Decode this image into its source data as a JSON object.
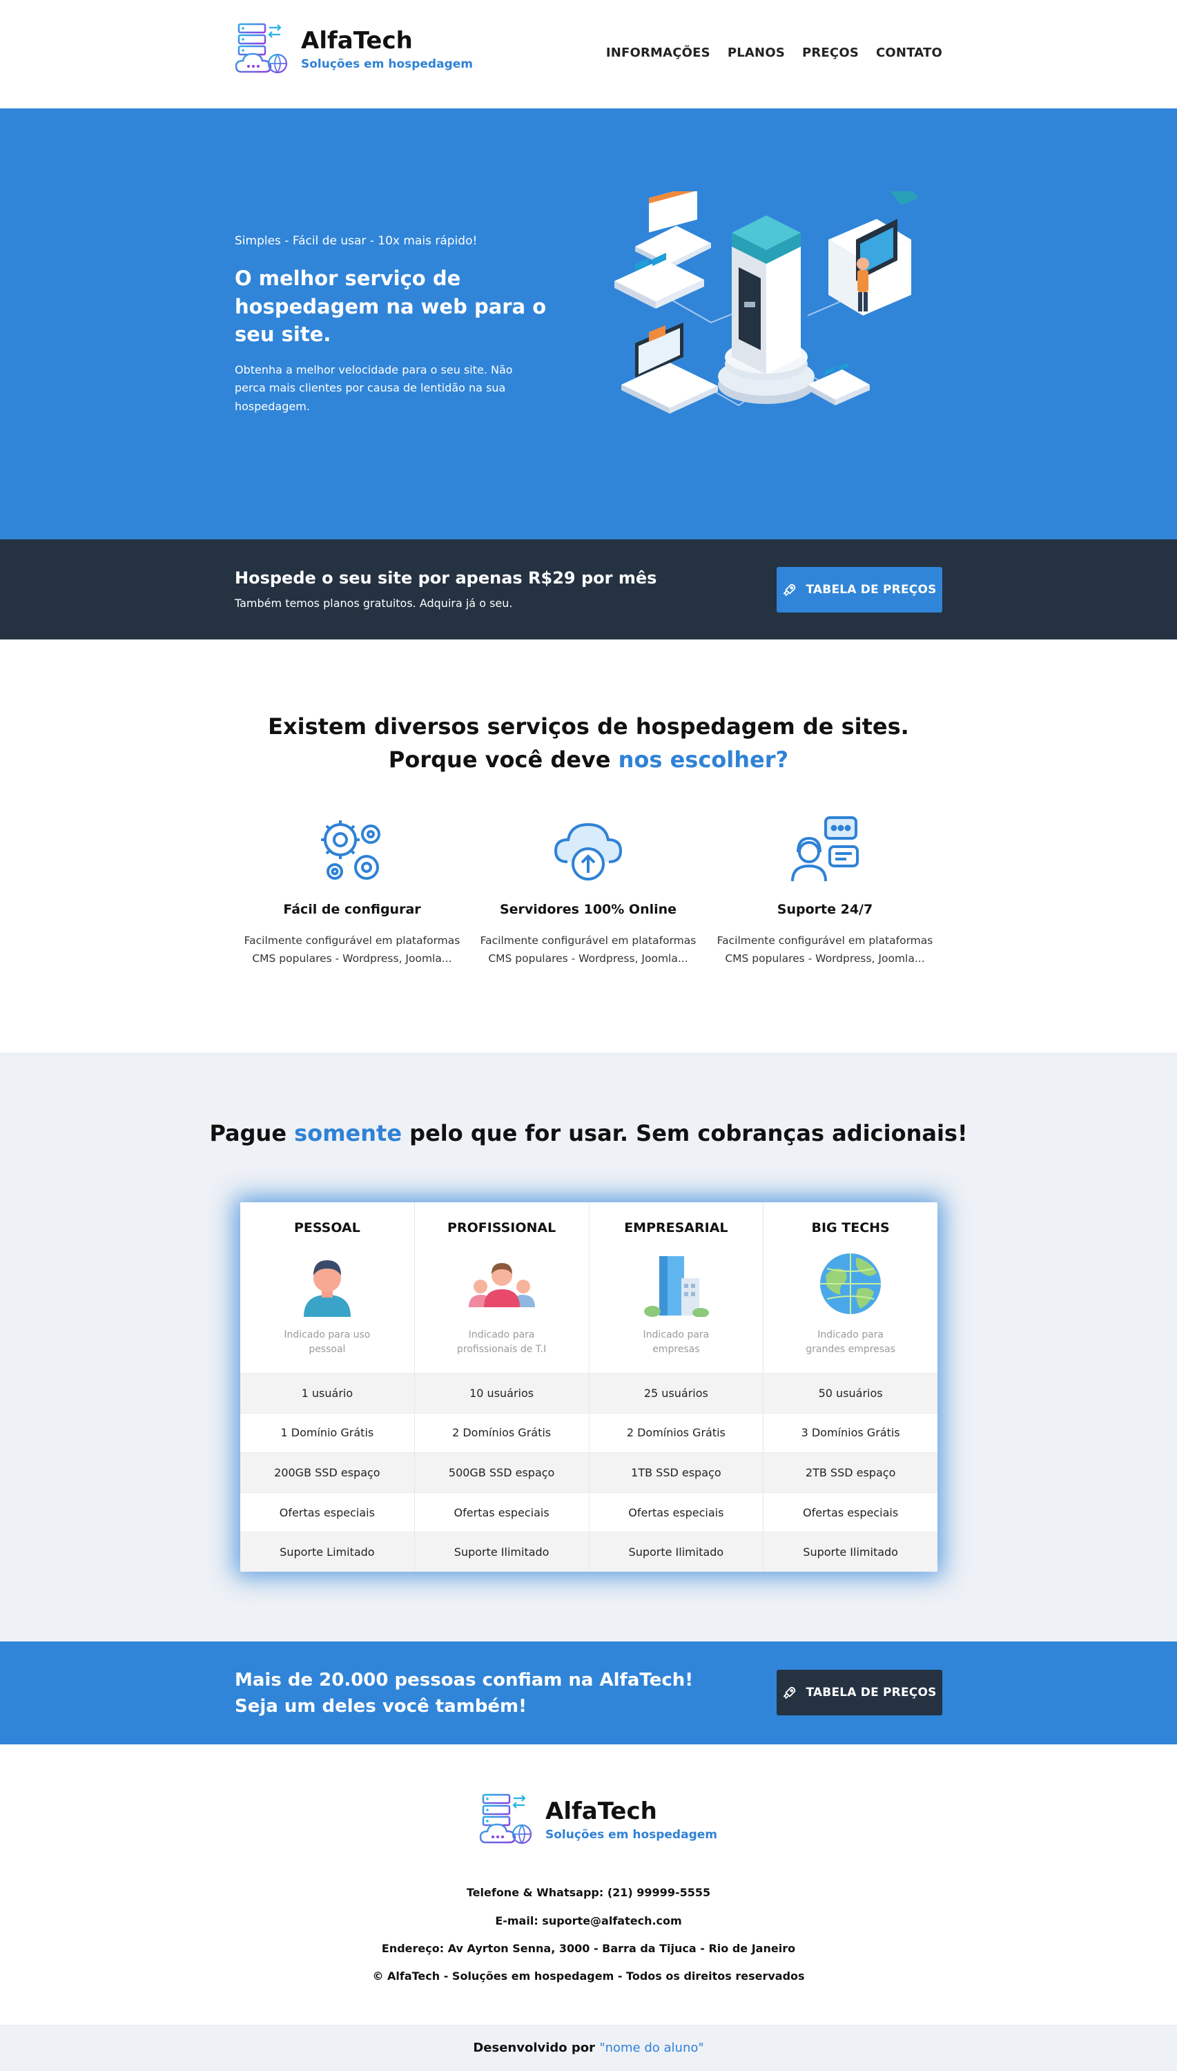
{
  "brand": {
    "name": "AlfaTech",
    "tagline": "Soluções em hospedagem"
  },
  "nav": {
    "items": [
      "INFORMAÇÕES",
      "PLANOS",
      "PREÇOS",
      "CONTATO"
    ]
  },
  "hero": {
    "tagline": "Simples - Fácil de usar - 10x mais rápido!",
    "title": "O melhor serviço de hospedagem na web para o seu site.",
    "text": "Obtenha a melhor velocidade para o seu site. Não perca mais clientes por causa de lentidão na sua hospedagem."
  },
  "promo": {
    "title": "Hospede o seu site por apenas R$29 por mês",
    "subtitle": "Também temos planos gratuitos. Adquira já o seu.",
    "button": "TABELA DE PREÇOS"
  },
  "features": {
    "title_line1": "Existem diversos serviços de hospedagem de sites.",
    "title_line2_prefix": "Porque você deve ",
    "title_line2_accent": "nos escolher?",
    "items": [
      {
        "icon": "gears-icon",
        "title": "Fácil de configurar",
        "text": "Facilmente configurável em plataformas CMS populares - Wordpress, Joomla..."
      },
      {
        "icon": "cloud-upload-icon",
        "title": "Servidores 100% Online",
        "text": "Facilmente configurável em plataformas CMS populares - Wordpress, Joomla..."
      },
      {
        "icon": "support-agent-icon",
        "title": "Suporte 24/7",
        "text": "Facilmente configurável em plataformas CMS populares - Wordpress, Joomla..."
      }
    ]
  },
  "pricing": {
    "title_prefix": "Pague ",
    "title_accent": "somente",
    "title_suffix": " pelo que for usar. Sem cobranças adicionais!",
    "plans": [
      {
        "name": "PESSOAL",
        "image": "person-icon",
        "desc": "Indicado para uso pessoal",
        "features": [
          "1 usuário",
          "1 Domínio Grátis",
          "200GB SSD espaço",
          "Ofertas especiais",
          "Suporte Limitado"
        ]
      },
      {
        "name": "PROFISSIONAL",
        "image": "team-icon",
        "desc": "Indicado para profissionais de T.I",
        "features": [
          "10 usuários",
          "2 Domínios Grátis",
          "500GB SSD espaço",
          "Ofertas especiais",
          "Suporte Ilimitado"
        ]
      },
      {
        "name": "EMPRESARIAL",
        "image": "building-icon",
        "desc": "Indicado para empresas",
        "features": [
          "25 usuários",
          "2 Domínios Grátis",
          "1TB SSD espaço",
          "Ofertas especiais",
          "Suporte Ilimitado"
        ]
      },
      {
        "name": "BIG TECHS",
        "image": "globe-icon",
        "desc": "Indicado para grandes empresas",
        "features": [
          "50 usuários",
          "3 Domínios Grátis",
          "2TB SSD espaço",
          "Ofertas especiais",
          "Suporte Ilimitado"
        ]
      }
    ]
  },
  "trust": {
    "line1": "Mais de 20.000 pessoas confiam na AlfaTech!",
    "line2": "Seja um deles você também!",
    "button": "TABELA DE PREÇOS"
  },
  "footer": {
    "phone": "Telefone & Whatsapp: (21) 99999-5555",
    "email": "E-mail: suporte@alfatech.com",
    "address": "Endereço: Av Ayrton Senna, 3000 - Barra da Tijuca - Rio de Janeiro",
    "copyright": "© AlfaTech - Soluções em hospedagem - Todos os direitos reservados"
  },
  "credits": {
    "prefix": "Desenvolvido por ",
    "link": "\"nome do aluno\""
  },
  "colors": {
    "accent": "#3085d8",
    "dark": "#243241",
    "light_bg": "#eef1f6"
  }
}
